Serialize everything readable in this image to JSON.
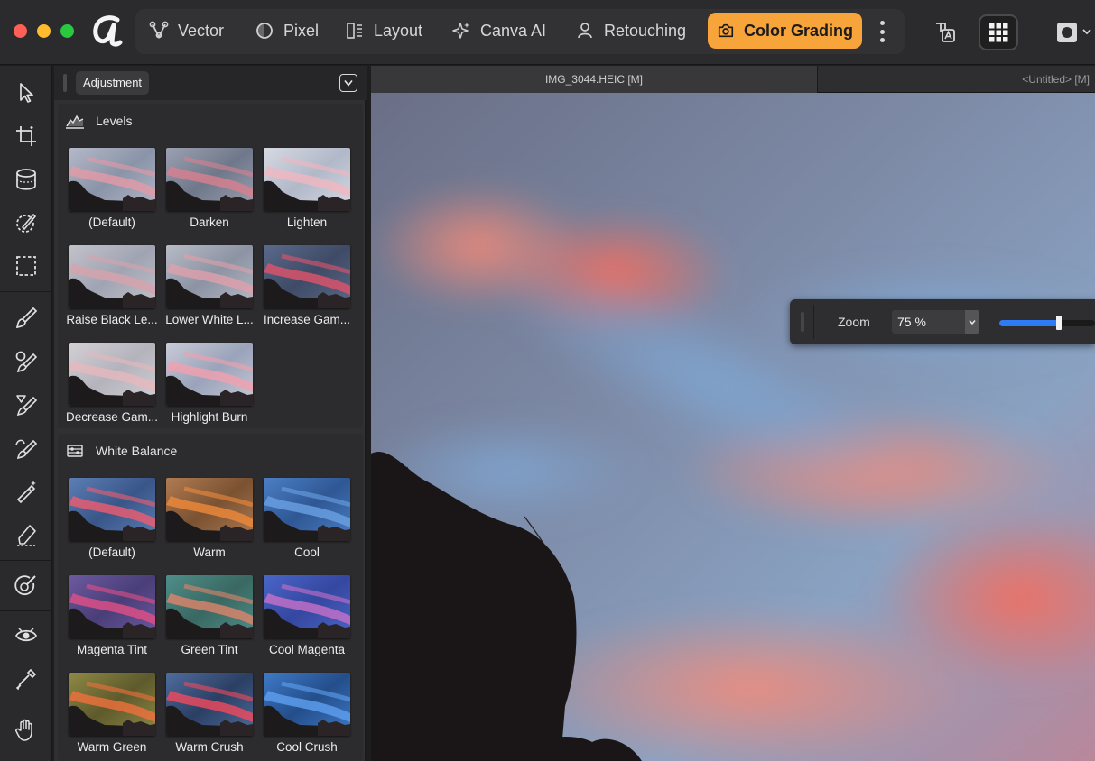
{
  "app": {
    "personas": [
      {
        "label": "Vector",
        "icon": "vector-persona-icon"
      },
      {
        "label": "Pixel",
        "icon": "pixel-persona-icon"
      },
      {
        "label": "Layout",
        "icon": "layout-persona-icon"
      },
      {
        "label": "Canva AI",
        "icon": "sparkle-icon"
      },
      {
        "label": "Retouching",
        "icon": "person-icon"
      },
      {
        "label": "Color Grading",
        "icon": "camera-icon",
        "active": true
      }
    ],
    "accent_color": "#f7a43b"
  },
  "panel": {
    "tab_label": "Adjustment",
    "sections": [
      {
        "title": "Levels",
        "presets": [
          "(Default)",
          "Darken",
          "Lighten",
          "Raise Black Le...",
          "Lower White L...",
          "Increase Gam...",
          "Decrease Gam...",
          "Highlight Burn"
        ]
      },
      {
        "title": "White Balance",
        "presets": [
          "(Default)",
          "Warm",
          "Cool",
          "Magenta Tint",
          "Green Tint",
          "Cool Magenta",
          "Warm Green",
          "Warm Crush",
          "Cool Crush"
        ]
      }
    ]
  },
  "documents": {
    "tabs": [
      "IMG_3044.HEIC [M]",
      "<Untitled> [M]"
    ]
  },
  "zoom": {
    "label": "Zoom",
    "value": "75 %",
    "slider_fraction": 0.62,
    "slider_color": "#2f7bf5"
  }
}
